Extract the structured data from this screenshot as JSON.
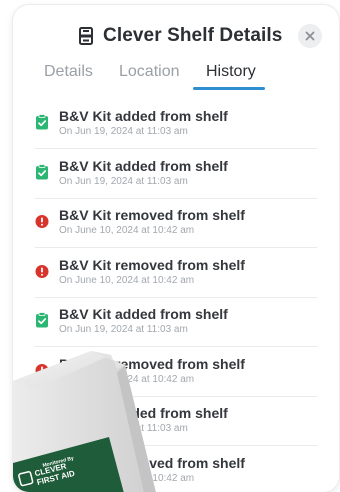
{
  "dialog": {
    "title": "Clever Shelf Details",
    "close_icon": "close-icon",
    "title_icon": "shelf-icon"
  },
  "tabs": [
    {
      "label": "Details",
      "active": false
    },
    {
      "label": "Location",
      "active": false
    },
    {
      "label": "History",
      "active": true
    }
  ],
  "history": [
    {
      "type": "added",
      "title": "B&V Kit added from shelf",
      "time": "On Jun 19, 2024 at 11:03 am"
    },
    {
      "type": "added",
      "title": "B&V Kit added from shelf",
      "time": "On Jun 19, 2024 at 11:03 am"
    },
    {
      "type": "removed",
      "title": "B&V Kit removed from shelf",
      "time": "On June 10, 2024 at 10:42 am"
    },
    {
      "type": "removed",
      "title": "B&V Kit removed from shelf",
      "time": "On June 10, 2024 at 10:42 am"
    },
    {
      "type": "added",
      "title": "B&V Kit added from shelf",
      "time": "On Jun 19, 2024 at 11:03 am"
    },
    {
      "type": "removed",
      "title": "B&V Kit removed from shelf",
      "time": "On June 10, 2024 at 10:42 am"
    },
    {
      "type": "added",
      "title": "B&V Kit added from shelf",
      "time": "On Jun 19, 2024 at 11:03 am"
    },
    {
      "type": "removed",
      "title": "B&V Kit removed from shelf",
      "time": "On June 10, 2024 at 10:42 am"
    }
  ],
  "product_box": {
    "label_line1": "Monitored By",
    "label_line2": "CLEVER",
    "label_line3": "FIRST AID"
  },
  "colors": {
    "accent": "#2d8fcf",
    "added_green": "#2bb673",
    "removed_red": "#d9342b",
    "box_green": "#1f5c3a"
  }
}
